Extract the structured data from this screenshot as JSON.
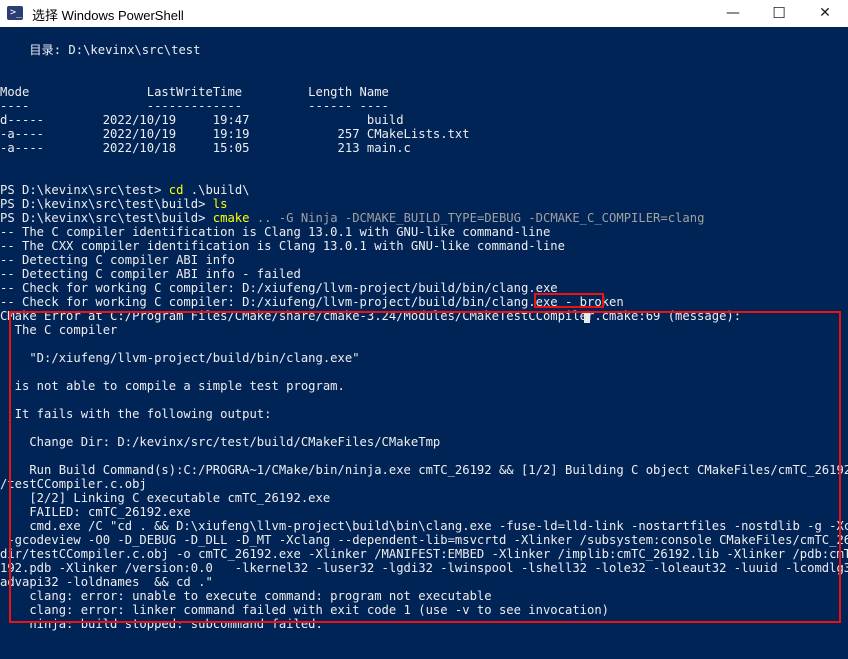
{
  "window": {
    "title": "选择 Windows PowerShell",
    "minimize": "—",
    "maximize": "☐",
    "close": "✕",
    "icon_glyph": ">_",
    "icon_name": "powershell-icon"
  },
  "colors": {
    "console_bg": "#012456",
    "text": "#eeedf0",
    "command": "#ffff00",
    "args": "#a0a0a0",
    "highlight": "#ee1111"
  },
  "console": {
    "directory_header": "    目录: D:\\kevinx\\src\\test",
    "listing": {
      "header": "Mode                LastWriteTime         Length Name",
      "separator": "----                -------------         ------ ----",
      "rows": [
        "d-----        2022/10/19     19:47                build",
        "-a----        2022/10/19     19:19            257 CMakeLists.txt",
        "-a----        2022/10/18     15:05            213 main.c"
      ]
    },
    "commands": [
      {
        "prompt": "PS D:\\kevinx\\src\\test> ",
        "cmd": "cd",
        "args": " .\\build\\"
      },
      {
        "prompt": "PS D:\\kevinx\\src\\test\\build> ",
        "cmd": "ls",
        "args": ""
      },
      {
        "prompt": "PS D:\\kevinx\\src\\test\\build> ",
        "cmd": "cmake",
        "args": " .. -G Ninja -DCMAKE_BUILD_TYPE=DEBUG -DCMAKE_C_COMPILER=clang"
      }
    ],
    "output": [
      "-- The C compiler identification is Clang 13.0.1 with GNU-like command-line",
      "-- The CXX compiler identification is Clang 13.0.1 with GNU-like command-line",
      "-- Detecting C compiler ABI info",
      "-- Detecting C compiler ABI info - failed",
      "-- Check for working C compiler: D:/xiufeng/llvm-project/build/bin/clang.exe",
      "-- Check for working C compiler: D:/xiufeng/llvm-project/build/bin/clang.exe - broken",
      "CMake Error at C:/Program Files/CMake/share/cmake-3.24/Modules/CMakeTestCCompiler.cmake:69 (message):",
      "  The C compiler",
      "",
      "    \"D:/xiufeng/llvm-project/build/bin/clang.exe\"",
      "",
      "  is not able to compile a simple test program.",
      "",
      "  It fails with the following output:",
      "",
      "    Change Dir: D:/kevinx/src/test/build/CMakeFiles/CMakeTmp",
      "",
      "    Run Build Command(s):C:/PROGRA~1/CMake/bin/ninja.exe cmTC_26192 && [1/2] Building C object CMakeFiles/cmTC_26192.dir",
      "/testCCompiler.c.obj",
      "    [2/2] Linking C executable cmTC_26192.exe",
      "    FAILED: cmTC_26192.exe",
      "    cmd.exe /C \"cd . && D:\\xiufeng\\llvm-project\\build\\bin\\clang.exe -fuse-ld=lld-link -nostartfiles -nostdlib -g -Xclang",
      " -gcodeview -O0 -D_DEBUG -D_DLL -D_MT -Xclang --dependent-lib=msvcrtd -Xlinker /subsystem:console CMakeFiles/cmTC_26192",
      "dir/testCCompiler.c.obj -o cmTC_26192.exe -Xlinker /MANIFEST:EMBED -Xlinker /implib:cmTC_26192.lib -Xlinker /pdb:cmTC_26",
      "192.pdb -Xlinker /version:0.0   -lkernel32 -luser32 -lgdi32 -lwinspool -lshell32 -lole32 -loleaut32 -luuid -lcomdlg32 -l",
      "advapi32 -loldnames  && cd .\"",
      "    clang: error: unable to execute command: program not executable",
      "    clang: error: linker command failed with exit code 1 (use -v to see invocation)",
      "    ninja: build stopped: subcommand failed."
    ]
  }
}
